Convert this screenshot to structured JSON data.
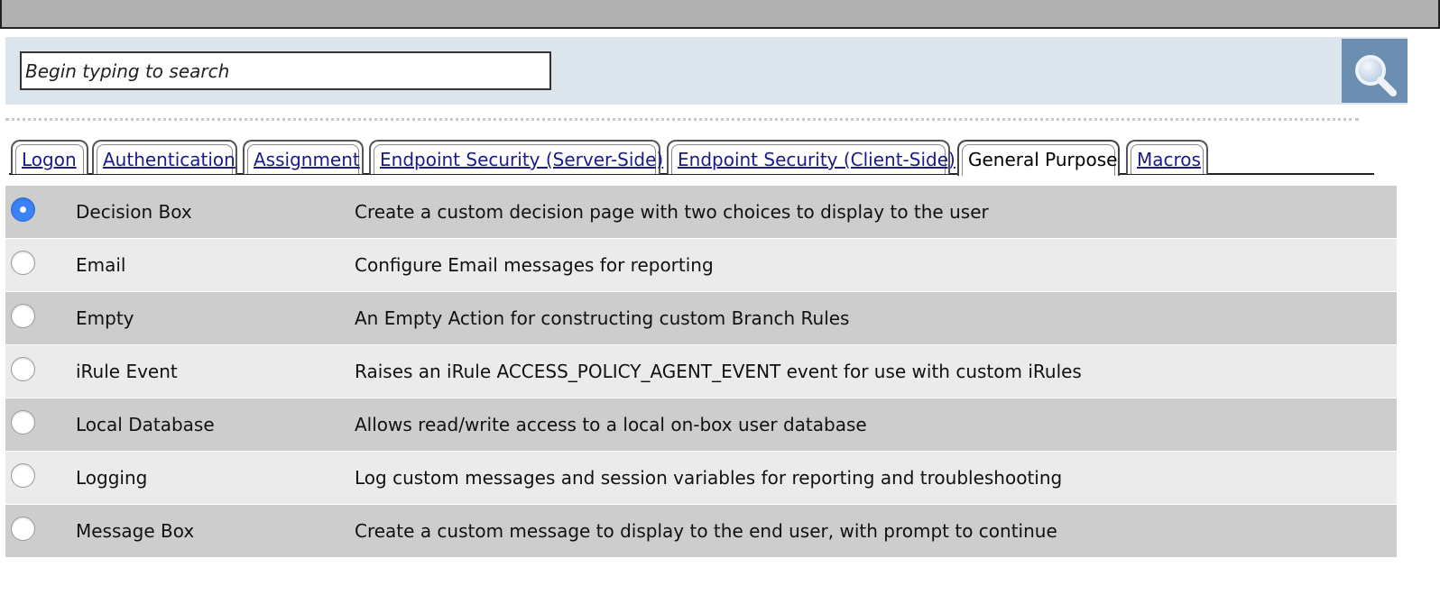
{
  "search": {
    "placeholder": "Begin typing to search",
    "button_icon": "magnifier-icon"
  },
  "tabs": [
    {
      "label": "Logon",
      "active": false
    },
    {
      "label": "Authentication",
      "active": false
    },
    {
      "label": "Assignment",
      "active": false
    },
    {
      "label": "Endpoint Security (Server-Side)",
      "active": false
    },
    {
      "label": "Endpoint Security (Client-Side)",
      "active": false
    },
    {
      "label": "General Purpose",
      "active": true
    },
    {
      "label": "Macros",
      "active": false
    }
  ],
  "items": [
    {
      "name": "Decision Box",
      "description": "Create a custom decision page with two choices to display to the user",
      "selected": true
    },
    {
      "name": "Email",
      "description": "Configure Email messages for reporting",
      "selected": false
    },
    {
      "name": "Empty",
      "description": "An Empty Action for constructing custom Branch Rules",
      "selected": false
    },
    {
      "name": "iRule Event",
      "description": "Raises an iRule ACCESS_POLICY_AGENT_EVENT event for use with custom iRules",
      "selected": false
    },
    {
      "name": "Local Database",
      "description": "Allows read/write access to a local on-box user database",
      "selected": false
    },
    {
      "name": "Logging",
      "description": "Log custom messages and session variables for reporting and troubleshooting",
      "selected": false
    },
    {
      "name": "Message Box",
      "description": "Create a custom message to display to the end user, with prompt to continue",
      "selected": false
    }
  ],
  "colors": {
    "search_bg": "#dce4ec",
    "search_button_bg": "#6c8fb1",
    "row_odd": "#cdcdcd",
    "row_even": "#ebebeb",
    "tab_link": "#1a1a8c",
    "radio_selected": "#3b82f6"
  }
}
